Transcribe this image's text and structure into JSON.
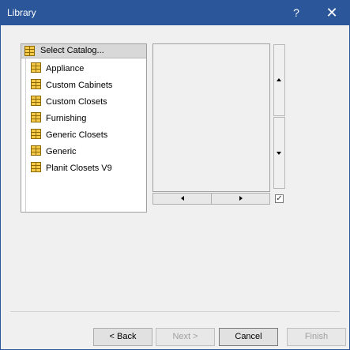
{
  "window": {
    "title": "Library",
    "help": "?",
    "close": "✕"
  },
  "tree": {
    "header": "Select Catalog...",
    "items": [
      {
        "label": "Appliance"
      },
      {
        "label": "Custom Cabinets"
      },
      {
        "label": "Custom Closets"
      },
      {
        "label": "Furnishing"
      },
      {
        "label": "Generic Closets"
      },
      {
        "label": "Generic"
      },
      {
        "label": "Planit Closets V9"
      }
    ]
  },
  "checkbox": {
    "checked": true,
    "mark": "✓"
  },
  "buttons": {
    "back": "< Back",
    "next": "Next >",
    "cancel": "Cancel",
    "finish": "Finish"
  }
}
